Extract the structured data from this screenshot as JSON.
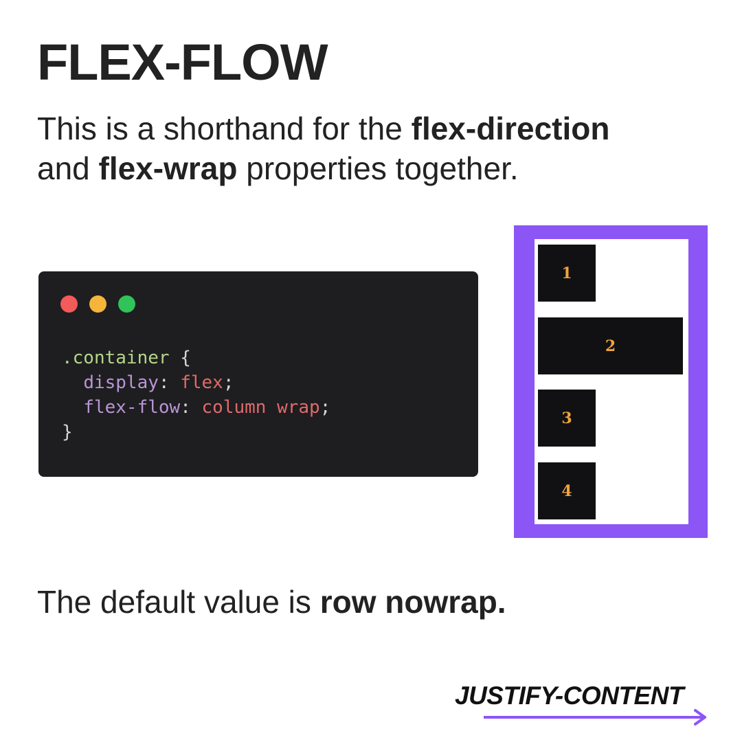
{
  "title": "FLEX-FLOW",
  "intro": {
    "text_before": "This is a shorthand for the ",
    "bold_1": "flex-direction",
    "text_between": " and ",
    "bold_2": "flex-wrap",
    "text_after": " properties together."
  },
  "code": {
    "window_dots": [
      "red",
      "yellow",
      "green"
    ],
    "selector": ".container",
    "open_brace": " {",
    "lines": [
      {
        "property": "display",
        "value": "flex"
      },
      {
        "property": "flex-flow",
        "value": "column wrap"
      }
    ],
    "close_brace": "}"
  },
  "demo": {
    "items": [
      "1",
      "2",
      "3",
      "4"
    ],
    "colors": {
      "frame": "#8c55f5",
      "item_bg": "#111114",
      "item_text": "#f0a33a"
    }
  },
  "footer": {
    "text_before": "The default value is ",
    "bold": "row nowrap."
  },
  "next": {
    "label": "JUSTIFY-CONTENT",
    "icon": "arrow-right-icon"
  },
  "colors": {
    "accent": "#8c55f5",
    "text": "#222222",
    "code_bg": "#1e1e20"
  }
}
